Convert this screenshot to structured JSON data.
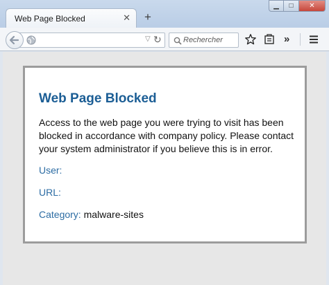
{
  "tab": {
    "title": "Web Page Blocked"
  },
  "search": {
    "placeholder": "Rechercher"
  },
  "page": {
    "heading": "Web Page Blocked",
    "message": "Access to the web page you were trying to visit has been blocked in accordance with company policy. Please contact your system administrator if you believe this is in error.",
    "user_label": "User:",
    "user_value": "",
    "url_label": "URL:",
    "url_value": "",
    "category_label": "Category:",
    "category_value": "malware-sites"
  }
}
